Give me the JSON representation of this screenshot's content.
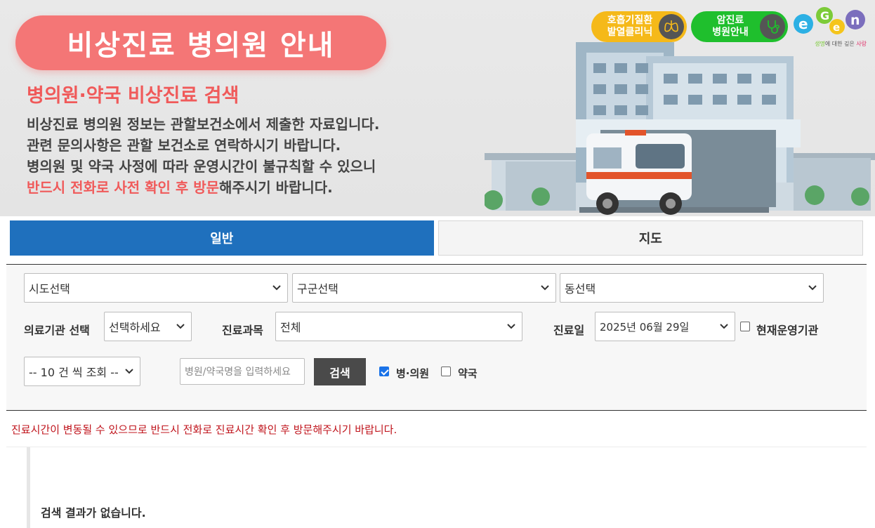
{
  "banner": {
    "title": "비상진료 병의원 안내",
    "subtitle": "병의원·약국 비상진료 검색",
    "desc_line1": "비상진료 병의원 정보는 관할보건소에서 제출한 자료입니다.",
    "desc_line2": "관련 문의사항은 관할 보건소로 연락하시기 바랍니다.",
    "desc_line3": "병의원 및 약국 사정에 따라 운영시간이 불규칙할 수 있으니",
    "desc_line4_highlight": "반드시 전화로 사전 확인 후 방문",
    "desc_line4_rest": "해주시기 바랍니다."
  },
  "quick_links": {
    "respiratory_line1": "호흡기질환",
    "respiratory_line2": "발열클리닉",
    "cancer_line1": "암진료",
    "cancer_line2": "병원안내",
    "logo_tagline_a": "생명",
    "logo_tagline_b": "에 대한 깊은",
    "logo_tagline_c": "사랑"
  },
  "tabs": [
    {
      "label": "일반",
      "active": true
    },
    {
      "label": "지도",
      "active": false
    }
  ],
  "form": {
    "sido_select": "시도선택",
    "gugun_select": "구군선택",
    "dong_select": "동선택",
    "institution_label": "의료기관 선택",
    "institution_select": "선택하세요",
    "department_label": "진료과목",
    "department_select": "전체",
    "date_label": "진료일",
    "date_select": "2025년 06월 29일",
    "operating_now_label": "현재운영기관",
    "operating_now_checked": false,
    "page_size_select": "-- 10 건 씩 조회 --",
    "search_placeholder": "병원/약국명을 입력하세요",
    "search_button": "검색",
    "hospital_label": "병·의원",
    "hospital_checked": true,
    "pharmacy_label": "약국",
    "pharmacy_checked": false
  },
  "notice": "진료시간이 변동될 수 있으므로 반드시 전화로 진료시간 확인 후 방문해주시기 바랍니다.",
  "result": {
    "empty_message": "검색 결과가 없습니다."
  },
  "colors": {
    "accent": "#1f70bd",
    "banner_pink": "#f47676",
    "notice_red": "#c0141c",
    "yellow": "#f5b919",
    "green": "#1fbf2d"
  }
}
